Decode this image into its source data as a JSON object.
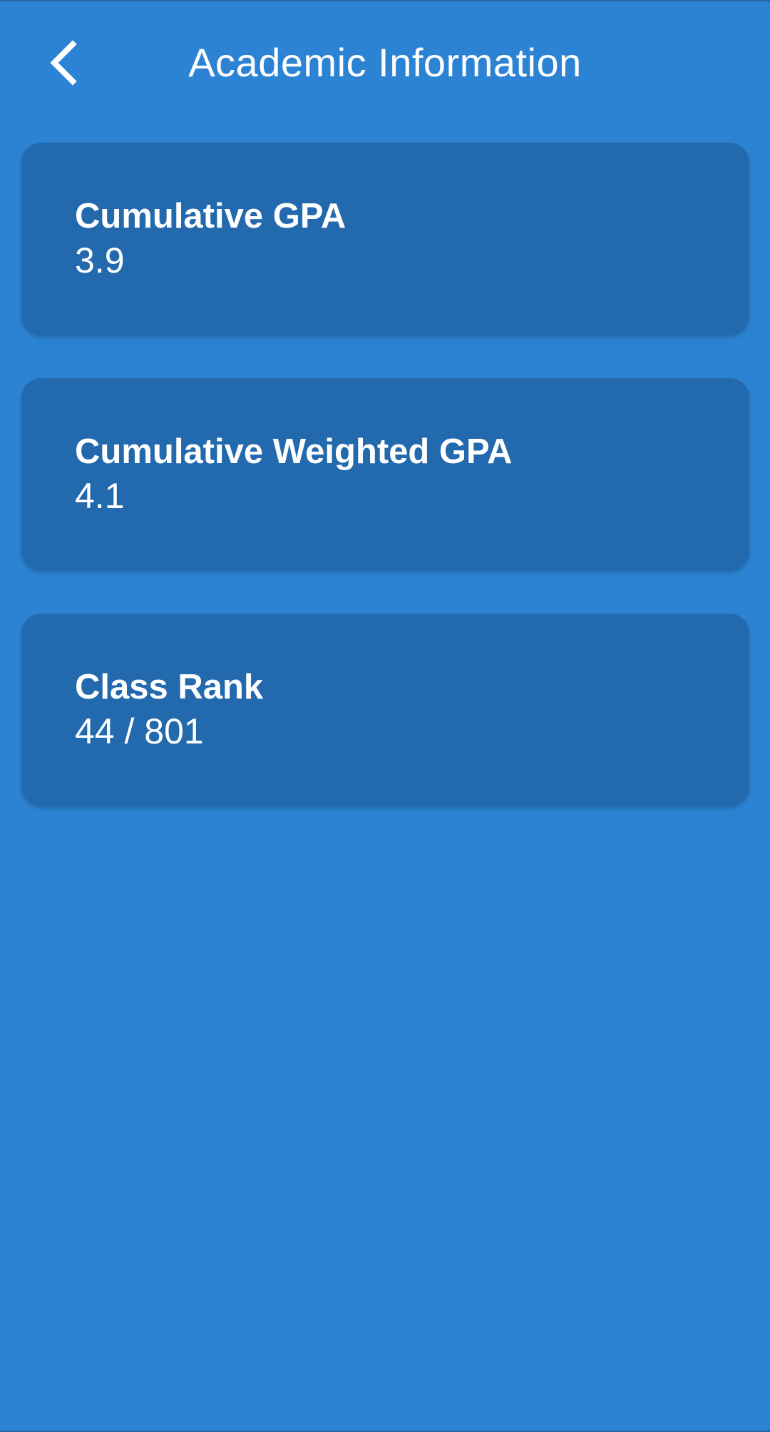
{
  "header": {
    "title": "Academic Information",
    "back_icon": "chevron-left-icon"
  },
  "colors": {
    "background": "#2c83d3",
    "card": "#2369ae",
    "text": "#ffffff"
  },
  "cards": [
    {
      "label": "Cumulative GPA",
      "value": "3.9"
    },
    {
      "label": "Cumulative Weighted GPA",
      "value": "4.1"
    },
    {
      "label": "Class Rank",
      "value": "44 / 801"
    }
  ]
}
